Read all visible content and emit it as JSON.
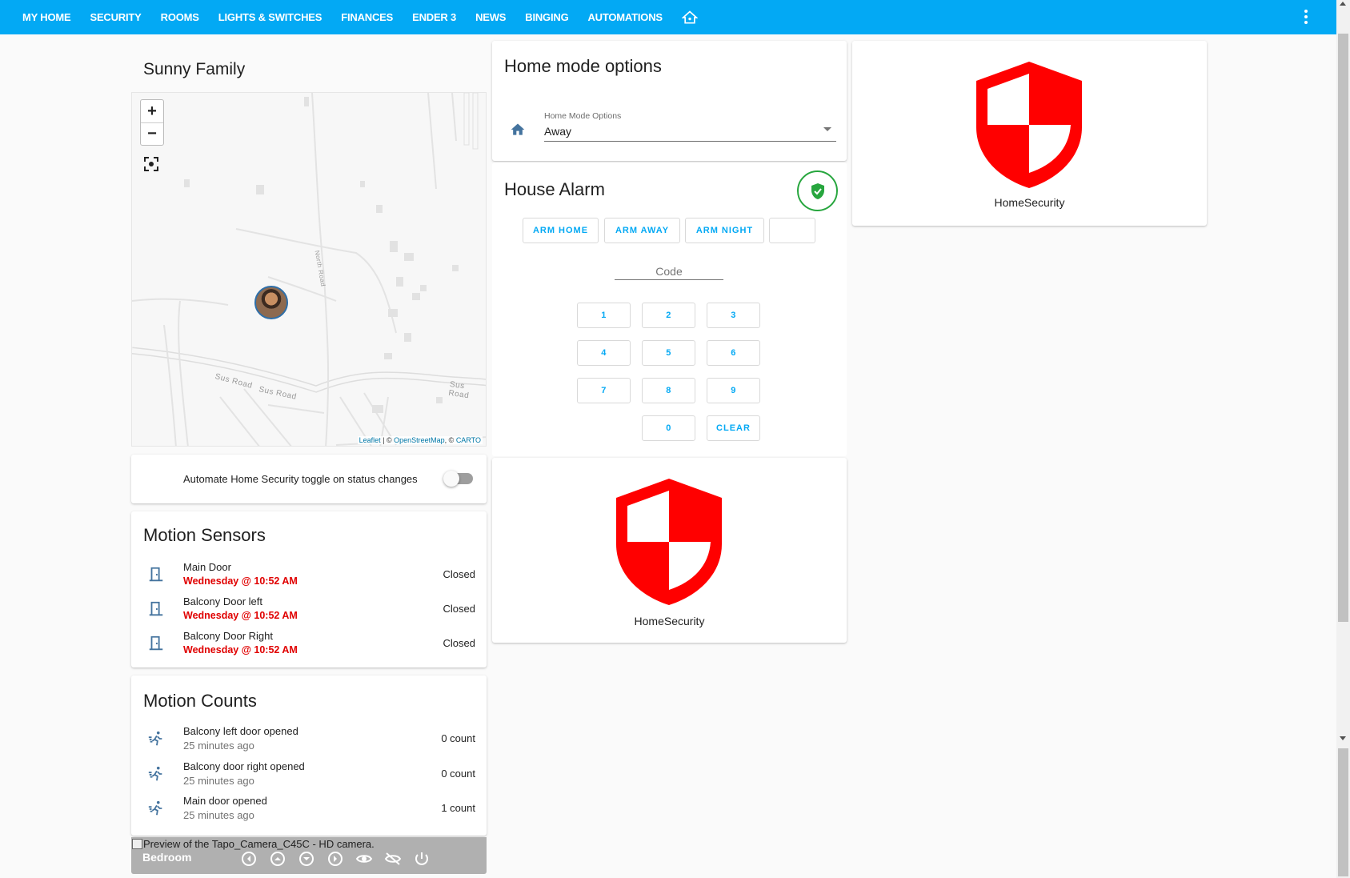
{
  "header": {
    "tabs": [
      {
        "label": "MY HOME"
      },
      {
        "label": "SECURITY"
      },
      {
        "label": "ROOMS"
      },
      {
        "label": "LIGHTS & SWITCHES"
      },
      {
        "label": "FINANCES"
      },
      {
        "label": "ENDER 3"
      },
      {
        "label": "NEWS"
      },
      {
        "label": "BINGING"
      },
      {
        "label": "AUTOMATIONS"
      }
    ],
    "extra_tab_icon": "home-automation-icon",
    "menu_icon": "dots-vertical-icon",
    "active_tab": "SECURITY",
    "accent_color": "#03a9f4"
  },
  "map_card": {
    "title": "Sunny Family",
    "zoom_in": "+",
    "zoom_out": "−",
    "road_labels": [
      "Sus Road",
      "Sus Road",
      "Sus Road",
      "North Road"
    ],
    "attribution": {
      "leaflet": "Leaflet",
      "sep1": " | © ",
      "osm": "OpenStreetMap",
      "sep2": ", © ",
      "carto": "CARTO"
    }
  },
  "toggle_card": {
    "label": "Automate Home Security toggle on status changes",
    "state": "off"
  },
  "motion_sensors": {
    "title": "Motion Sensors",
    "items": [
      {
        "name": "Main Door",
        "last_changed": "Wednesday @ 10:52 AM",
        "state": "Closed"
      },
      {
        "name": "Balcony Door left",
        "last_changed": "Wednesday @ 10:52 AM",
        "state": "Closed"
      },
      {
        "name": "Balcony Door Right",
        "last_changed": "Wednesday @ 10:52 AM",
        "state": "Closed"
      }
    ]
  },
  "motion_counts": {
    "title": "Motion Counts",
    "items": [
      {
        "name": "Balcony left door opened",
        "when": "25 minutes ago",
        "value": "0 count"
      },
      {
        "name": "Balcony door right opened",
        "when": "25 minutes ago",
        "value": "0 count"
      },
      {
        "name": "Main door opened",
        "when": "25 minutes ago",
        "value": "1 count"
      }
    ]
  },
  "camera": {
    "preview_alt": "Preview of the Tapo_Camera_C45C - HD camera.",
    "name": "Bedroom"
  },
  "home_mode": {
    "title": "Home mode options",
    "select_label": "Home Mode Options",
    "select_value": "Away"
  },
  "alarm": {
    "title": "House Alarm",
    "status_color": "#27a63e",
    "buttons": {
      "arm_home": "ARM HOME",
      "arm_away": "ARM AWAY",
      "arm_night": "ARM NIGHT"
    },
    "code_placeholder": "Code",
    "keys": [
      "1",
      "2",
      "3",
      "4",
      "5",
      "6",
      "7",
      "8",
      "9",
      "0"
    ],
    "clear": "CLEAR"
  },
  "home_security": {
    "label": "HomeSecurity",
    "shield_color": "#ff0000"
  }
}
